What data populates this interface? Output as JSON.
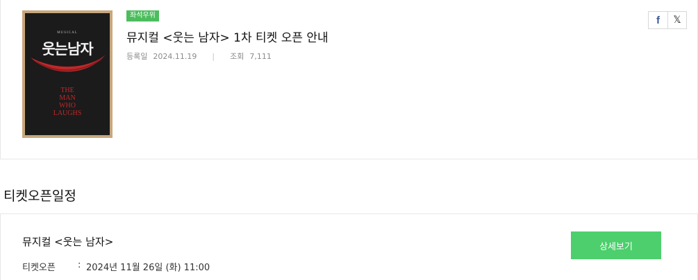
{
  "notice": {
    "poster": {
      "musical_label": "MUSICAL",
      "title_ko": "웃는남자",
      "title_en_lines": [
        "THE",
        "MAN",
        "WHO",
        "LAUGHS"
      ]
    },
    "badge": "좌석우위",
    "title": "뮤지컬 <웃는 남자> 1차 티켓 오픈 안내",
    "date_label": "등록일",
    "date_value": "2024.11.19",
    "separator": "|",
    "views_label": "조회",
    "views_value": "7,111"
  },
  "share": {
    "facebook_label": "f",
    "x_label": "𝕏"
  },
  "schedule": {
    "section_title": "티켓오픈일정",
    "show_name": "뮤지컬 <웃는 남자>",
    "open_label": "티켓오픈",
    "colon": ":",
    "open_value": "2024년 11월 26일 (화) 11:00",
    "detail_button": "상세보기"
  },
  "colors": {
    "badge": "#4cbd5d",
    "detail_button": "#4ccf6c",
    "facebook": "#3b5998",
    "poster_red": "#c0282a"
  }
}
